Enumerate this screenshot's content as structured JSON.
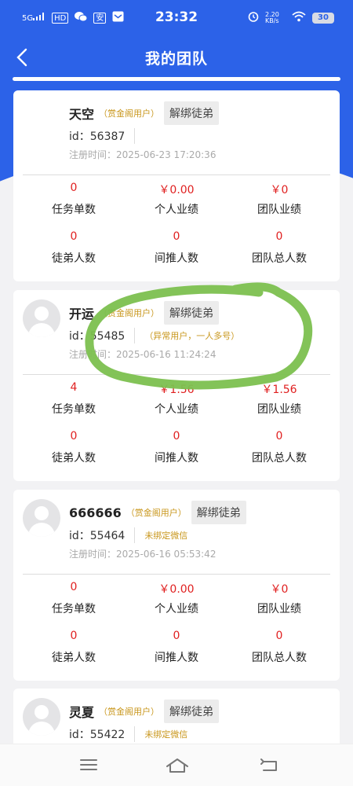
{
  "status_bar": {
    "network": "5G",
    "hd": "HD",
    "time": "23:32",
    "net_speed": "2.20 KB/s",
    "battery": "30"
  },
  "navbar": {
    "title": "我的团队"
  },
  "unbind_label": "解绑徒弟",
  "stat_labels": {
    "task_count": "任务单数",
    "personal_perf": "个人业绩",
    "team_perf": "团队业绩",
    "apprentice_count": "徒弟人数",
    "indirect_count": "间推人数",
    "team_total": "团队总人数"
  },
  "members": [
    {
      "name": "天空",
      "tag": "（赏金阁用户）",
      "id": "id：56387",
      "note": "",
      "reg": "注册时间：2025-06-23 17:20:36",
      "task_count": "0",
      "personal_perf": "￥0.00",
      "team_perf": "￥0",
      "apprentice_count": "0",
      "indirect_count": "0",
      "team_total": "0"
    },
    {
      "name": "开运",
      "tag": "（赏金阁用户）",
      "id": "id：55485",
      "note": "（异常用户，一人多号）",
      "reg": "注册时间：2025-06-16 11:24:24",
      "task_count": "4",
      "personal_perf": "￥1.56",
      "team_perf": "￥1.56",
      "apprentice_count": "0",
      "indirect_count": "0",
      "team_total": "0"
    },
    {
      "name": "666666",
      "tag": "（赏金阁用户）",
      "id": "id：55464",
      "note": "未绑定微信",
      "reg": "注册时间：2025-06-16 05:53:42",
      "task_count": "0",
      "personal_perf": "￥0.00",
      "team_perf": "￥0",
      "apprentice_count": "0",
      "indirect_count": "0",
      "team_total": "0"
    },
    {
      "name": "灵夏",
      "tag": "（赏金阁用户）",
      "id": "id：55422",
      "note": "未绑定微信",
      "reg": "",
      "task_count": "",
      "personal_perf": "",
      "team_perf": "",
      "apprentice_count": "",
      "indirect_count": "",
      "team_total": ""
    }
  ]
}
